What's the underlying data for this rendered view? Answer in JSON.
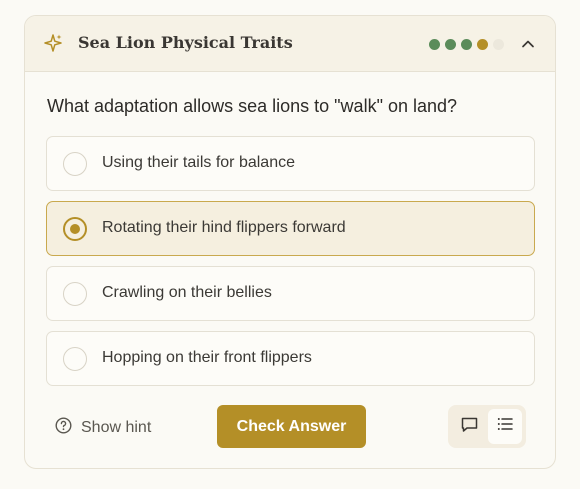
{
  "header": {
    "title": "Sea Lion Physical Traits",
    "progress_dots": [
      "#5b8c5a",
      "#5b8c5a",
      "#5b8c5a",
      "#b48f27",
      "#ece8dc"
    ]
  },
  "question": {
    "text": "What adaptation allows sea lions to \"walk\" on land?",
    "options": [
      {
        "label": "Using their tails for balance",
        "selected": false
      },
      {
        "label": "Rotating their hind flippers forward",
        "selected": true
      },
      {
        "label": "Crawling on their bellies",
        "selected": false
      },
      {
        "label": "Hopping on their front flippers",
        "selected": false
      }
    ]
  },
  "footer": {
    "hint_label": "Show hint",
    "check_label": "Check Answer"
  },
  "colors": {
    "accent": "#b48f27",
    "correct_green": "#5b8c5a"
  }
}
